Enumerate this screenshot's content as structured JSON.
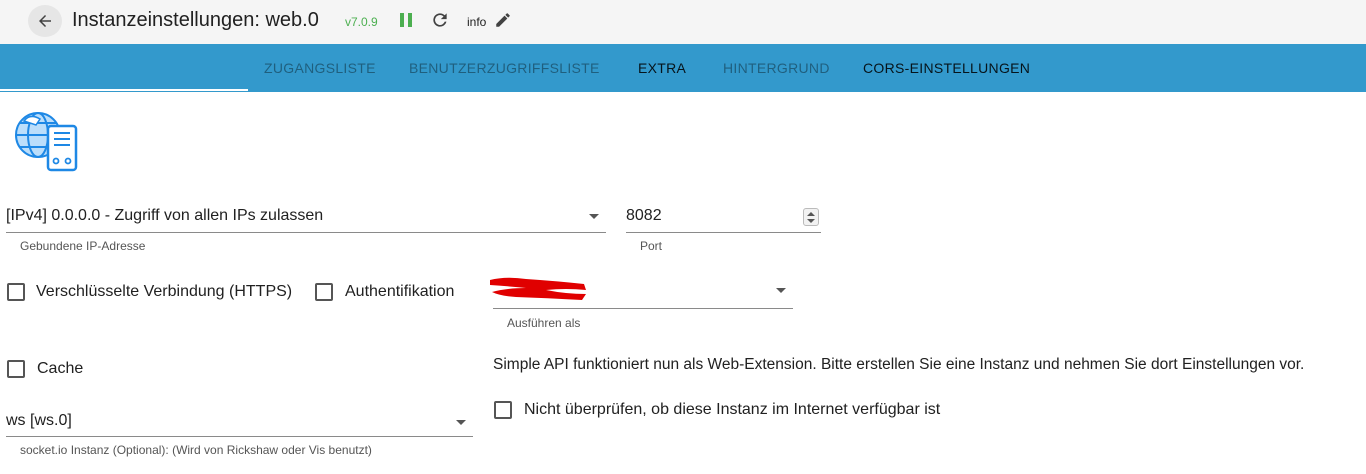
{
  "header": {
    "title": "Instanzeinstellungen: web.0",
    "version": "v7.0.9",
    "info_label": "info"
  },
  "tabs": [
    {
      "label": "ZUGANGSLISTE",
      "active": false
    },
    {
      "label": "BENUTZERZUGRIFFSLISTE",
      "active": false
    },
    {
      "label": "EXTRA",
      "active": true
    },
    {
      "label": "HINTERGRUND",
      "active": false
    },
    {
      "label": "CORS-EINSTELLUNGEN",
      "active": true
    }
  ],
  "form": {
    "bind_ip": {
      "value": "[IPv4] 0.0.0.0 - Zugriff von allen IPs zulassen",
      "helper": "Gebundene IP-Adresse"
    },
    "port": {
      "value": "8082",
      "helper": "Port"
    },
    "https": {
      "label": "Verschlüsselte Verbindung (HTTPS)",
      "checked": false
    },
    "auth": {
      "label": "Authentifikation",
      "checked": false
    },
    "run_as": {
      "value": "",
      "helper": "Ausführen als"
    },
    "cache": {
      "label": "Cache",
      "checked": false
    },
    "socketio": {
      "value": "ws [ws.0]",
      "helper": "socket.io Instanz (Optional): (Wird von Rickshaw oder Vis benutzt)"
    },
    "simple_api_note": "Simple API funktioniert nun als Web-Extension. Bitte erstellen Sie eine Instanz und nehmen Sie dort Einstellungen vor.",
    "no_check": {
      "label": "Nicht überprüfen, ob diese Instanz im Internet verfügbar ist",
      "checked": false
    }
  },
  "colors": {
    "tabbar": "#3399cc",
    "version": "#4caf50",
    "redaction": "#e00000"
  }
}
